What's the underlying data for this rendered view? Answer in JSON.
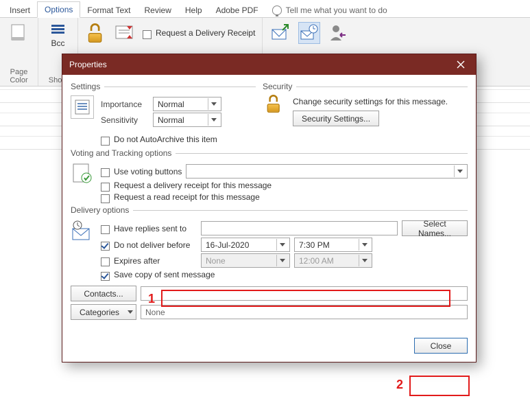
{
  "tabs": {
    "insert": "Insert",
    "options": "Options",
    "format_text": "Format Text",
    "review": "Review",
    "help": "Help",
    "adobe_pdf": "Adobe PDF",
    "tell_me": "Tell me what you want to do"
  },
  "ribbon": {
    "page_color": "Page\nColor",
    "bcc": "Bcc",
    "show": "Show",
    "request_delivery_receipt": "Request a Delivery Receipt"
  },
  "dialog": {
    "title": "Properties",
    "settings": {
      "legend": "Settings",
      "importance_label": "Importance",
      "importance_value": "Normal",
      "sensitivity_label": "Sensitivity",
      "sensitivity_value": "Normal",
      "autoarchive": "Do not AutoArchive this item"
    },
    "security": {
      "legend": "Security",
      "desc": "Change security settings for this message.",
      "button": "Security Settings..."
    },
    "voting": {
      "legend": "Voting and Tracking options",
      "use_voting": "Use voting buttons",
      "req_delivery": "Request a delivery receipt for this message",
      "req_read": "Request a read receipt for this message"
    },
    "delivery": {
      "legend": "Delivery options",
      "have_replies": "Have replies sent to",
      "select_names": "Select Names...",
      "do_not_deliver": "Do not deliver before",
      "date": "16-Jul-2020",
      "time": "7:30 PM",
      "expires": "Expires after",
      "exp_date": "None",
      "exp_time": "12:00 AM",
      "save_copy": "Save copy of sent message",
      "contacts": "Contacts...",
      "categories": "Categories",
      "categories_value": "None"
    },
    "close": "Close"
  },
  "annotations": {
    "one": "1",
    "two": "2"
  }
}
